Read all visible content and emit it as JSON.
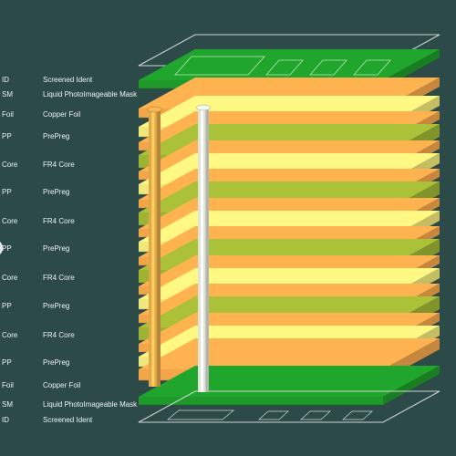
{
  "layers": [
    {
      "code": "ID",
      "desc": "Screened Ident",
      "kind": "ident"
    },
    {
      "code": "SM",
      "desc": "Liquid PhotoImageable Mask",
      "kind": "mask"
    },
    {
      "code": "Foil",
      "desc": "Copper Foil",
      "kind": "foil"
    },
    {
      "code": "PP",
      "desc": "PrePreg",
      "kind": "prepreg"
    },
    {
      "code": "Core",
      "desc": "FR4 Core",
      "kind": "core"
    },
    {
      "code": "PP",
      "desc": "PrePreg",
      "kind": "prepreg"
    },
    {
      "code": "Core",
      "desc": "FR4 Core",
      "kind": "core"
    },
    {
      "code": "PP",
      "desc": "PrePreg",
      "kind": "prepreg"
    },
    {
      "code": "Core",
      "desc": "FR4 Core",
      "kind": "core"
    },
    {
      "code": "PP",
      "desc": "PrePreg",
      "kind": "prepreg"
    },
    {
      "code": "Core",
      "desc": "FR4 Core",
      "kind": "core"
    },
    {
      "code": "PP",
      "desc": "PrePreg",
      "kind": "prepreg"
    },
    {
      "code": "Foil",
      "desc": "Copper Foil",
      "kind": "foil"
    },
    {
      "code": "SM",
      "desc": "Liquid PhotoImageable Mask",
      "kind": "mask"
    },
    {
      "code": "ID",
      "desc": "Screened Ident",
      "kind": "ident"
    }
  ],
  "colors": {
    "background": "#2c4a48",
    "copper": "#f3a54a",
    "prepreg": "#f0e77a",
    "core": "#9db334",
    "mask": "#1f9a2a",
    "ident": "#cfd6d4",
    "via_gold": "#e2a64a",
    "via_silver": "#dfe3d9"
  }
}
